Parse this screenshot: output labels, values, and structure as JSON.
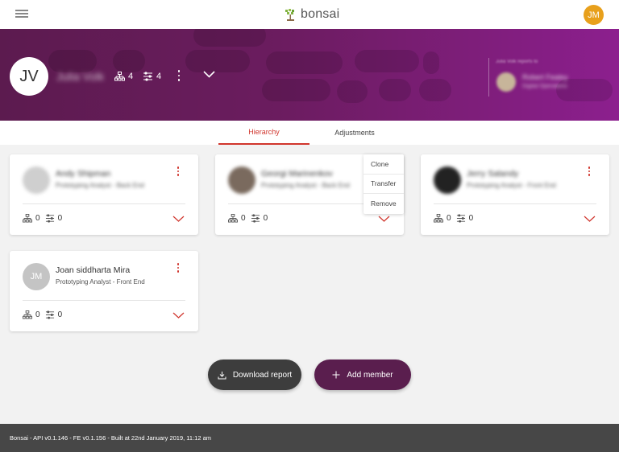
{
  "header": {
    "logo_text": "bonsai",
    "user_initials": "JM",
    "user_avatar_color": "#e8a01c"
  },
  "profile": {
    "initials": "JV",
    "name": "Julia Volk",
    "hierarchy_count": "4",
    "adjustments_count": "4",
    "reports_to_label": "Julia Volk reports to",
    "manager_name": "Robert Fealey",
    "manager_role": "Digital Operations"
  },
  "tabs": [
    {
      "label": "Hierarchy",
      "active": true
    },
    {
      "label": "Adjustments",
      "active": false
    }
  ],
  "members": [
    {
      "initials": "",
      "name": "Andy Shipman",
      "role": "Prototyping Analyst - Back End",
      "hierarchy": "0",
      "adjustments": "0"
    },
    {
      "initials": "",
      "name": "Georgi Marinenkov",
      "role": "Prototyping Analyst - Back End",
      "hierarchy": "0",
      "adjustments": "0"
    },
    {
      "initials": "",
      "name": "Jerry Salandy",
      "role": "Prototyping Analyst - Front End",
      "hierarchy": "0",
      "adjustments": "0"
    },
    {
      "initials": "JM",
      "name": "Joan siddharta Mira",
      "role": "Prototyping Analyst - Front End",
      "hierarchy": "0",
      "adjustments": "0"
    }
  ],
  "context_menu": [
    "Clone",
    "Transfer",
    "Remove"
  ],
  "actions": {
    "download_label": "Download report",
    "add_label": "Add member"
  },
  "footer": {
    "text": "Bonsai - API v0.1.146 - FE v0.1.156 - Built at 22nd January 2019, 11:12 am"
  },
  "colors": {
    "accent": "#d0342c",
    "banner_start": "#5c1b4f",
    "banner_end": "#8c1f8e",
    "primary_button": "#5a1e4e",
    "dark_button": "#3d3d3d",
    "footer_bg": "#474747"
  }
}
